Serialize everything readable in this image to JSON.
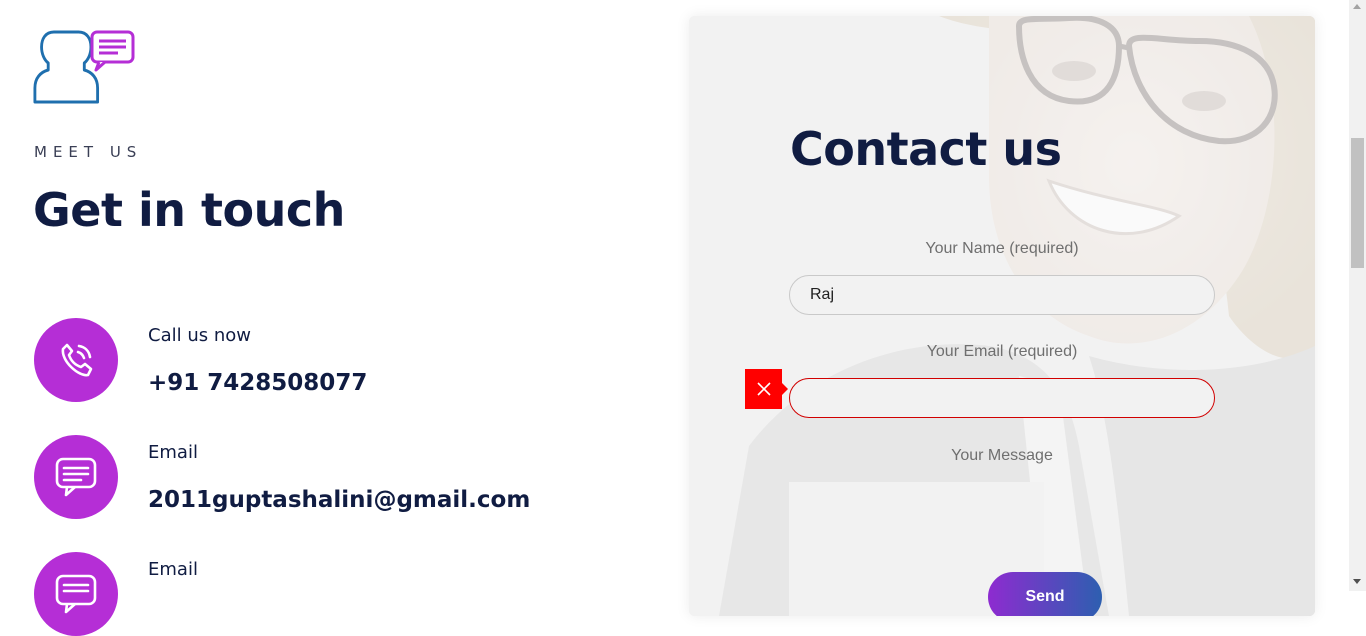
{
  "left": {
    "eyebrow": "MEET US",
    "headline": "Get in touch",
    "contacts": [
      {
        "icon": "phone-icon",
        "label": "Call us now",
        "value": "+91 7428508077"
      },
      {
        "icon": "chat-icon",
        "label": "Email",
        "value": "2011guptashalini@gmail.com"
      },
      {
        "icon": "chat-icon",
        "label": "Email",
        "value": ""
      }
    ]
  },
  "form": {
    "title": "Contact us",
    "name_label": "Your Name (required)",
    "name_value": "Raj",
    "email_label": "Your Email (required)",
    "email_value": "",
    "message_label": "Your Message",
    "submit_label": "Send",
    "error_icon": "close-icon"
  },
  "colors": {
    "accent_purple": "#b52ed6",
    "heading_navy": "#101c42",
    "error_red": "#ff0000",
    "logo_blue": "#1f6fae"
  }
}
